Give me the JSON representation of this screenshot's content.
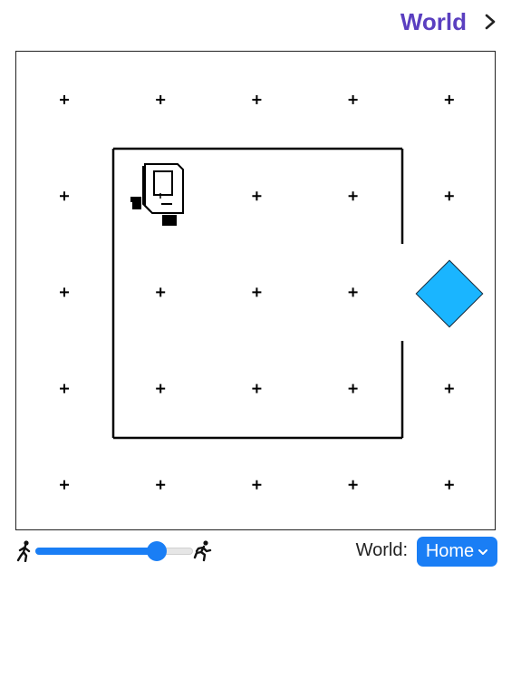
{
  "header": {
    "title": "World",
    "icon": "chevron-right-icon"
  },
  "world": {
    "grid_columns": 5,
    "grid_rows": 5,
    "robot": {
      "icon": "robot-icon",
      "column": 2,
      "row": 2,
      "facing": "east"
    },
    "goal": {
      "icon": "diamond-goal-icon",
      "column": 5,
      "row": 3,
      "color": "#1ab5ff"
    },
    "marker_icon": "plus-icon"
  },
  "controls": {
    "slow_icon": "walking-person-icon",
    "fast_icon": "running-person-icon",
    "speed_level": 0.77,
    "accent_color": "#1a7ef5",
    "world_label": "World:",
    "world_select": {
      "value": "Home",
      "icon": "chevron-down-icon"
    }
  }
}
